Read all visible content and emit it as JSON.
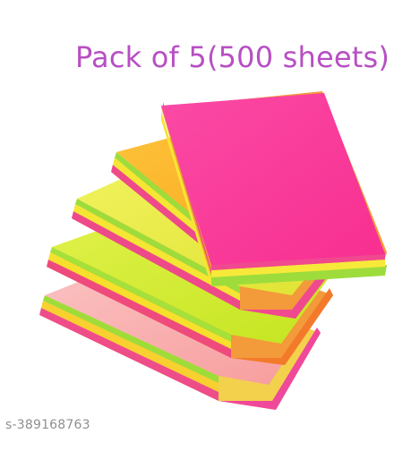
{
  "listing": {
    "headline": "Pack of 5(500 sheets)",
    "sku_code": "s-389168763"
  },
  "product": {
    "pads": [
      {
        "name": "pink-pastel-pad",
        "color": "#f8a9a9"
      },
      {
        "name": "lime-pad",
        "color": "#cfe92a"
      },
      {
        "name": "yellow-pad",
        "color": "#e7ea44"
      },
      {
        "name": "orange-pad",
        "color": "#fbb01a"
      },
      {
        "name": "magenta-pad",
        "color": "#f93e9d"
      }
    ]
  },
  "colors": {
    "headline": "#b74fc3",
    "sku": "#8f8f8f",
    "background": "#ffffff"
  }
}
